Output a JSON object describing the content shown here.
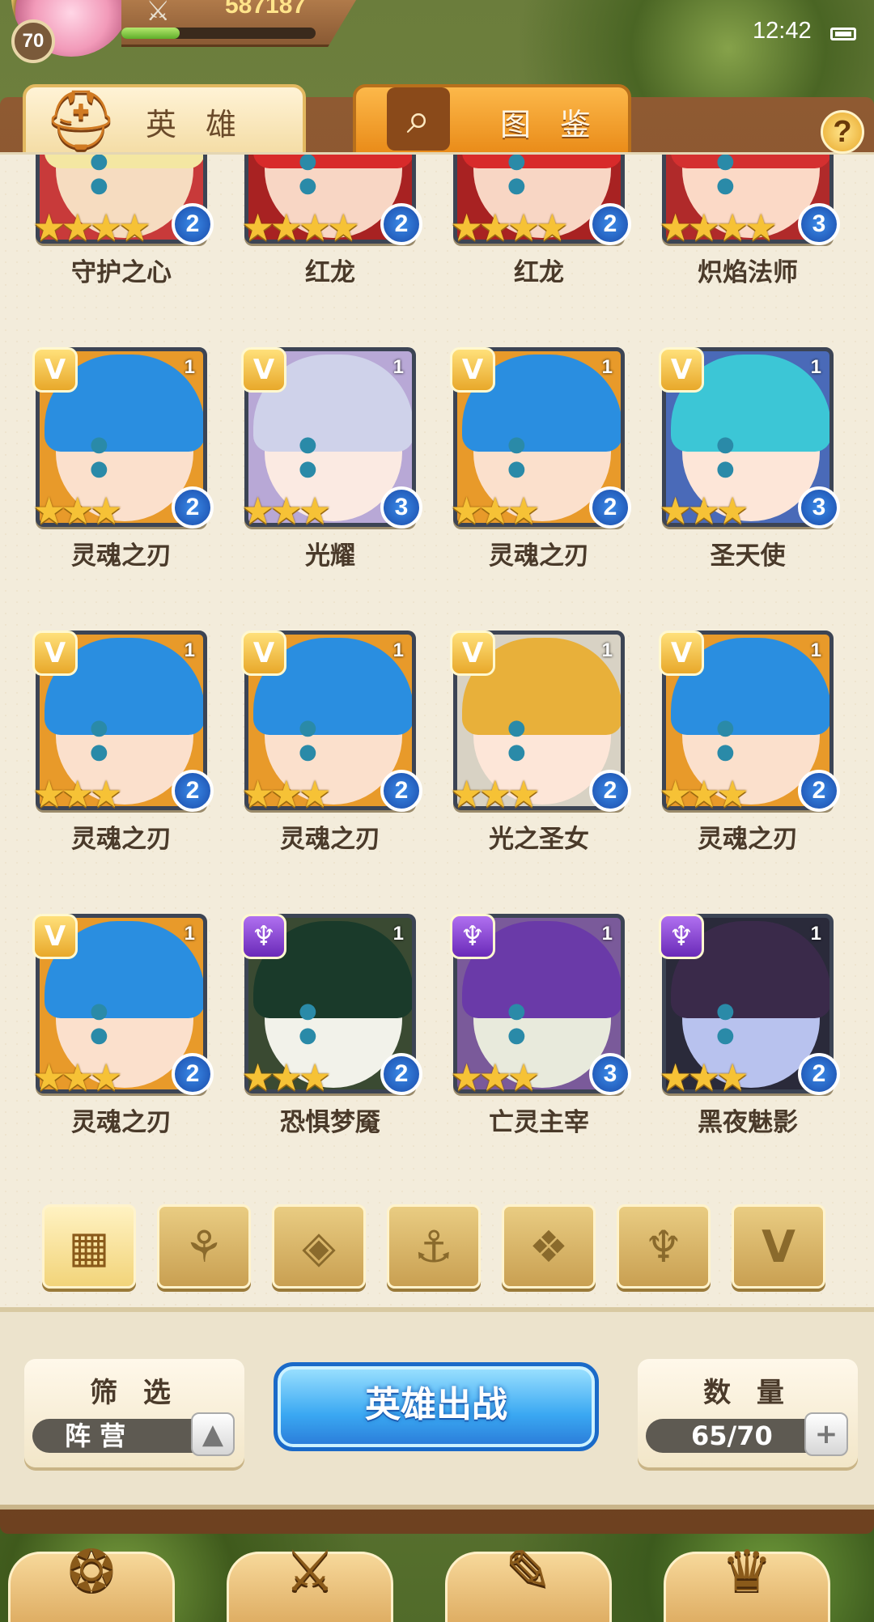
{
  "status": {
    "clock": "12:42"
  },
  "player": {
    "level": "70",
    "power": "587187",
    "exp_fraction": 0.3
  },
  "tabs": {
    "hero": "英 雄",
    "codex": "图 鉴"
  },
  "help_label": "?",
  "heroes": [
    {
      "name": "守护之心",
      "stars": 4,
      "level": "2",
      "faction": "gold",
      "rank": "",
      "portrait_color": "#f6dcc0",
      "hair_color": "#f4e7a2",
      "bg": "#c83a3a"
    },
    {
      "name": "红龙",
      "stars": 4,
      "level": "2",
      "faction": "gold",
      "rank": "",
      "portrait_color": "#f8d6c4",
      "hair_color": "#d82a2a",
      "bg": "#a82222"
    },
    {
      "name": "红龙",
      "stars": 4,
      "level": "2",
      "faction": "gold",
      "rank": "",
      "portrait_color": "#f8d6c4",
      "hair_color": "#d82a2a",
      "bg": "#a82222"
    },
    {
      "name": "炽焰法师",
      "stars": 4,
      "level": "3",
      "faction": "gold",
      "rank": "",
      "portrait_color": "#fbd9c6",
      "hair_color": "#d43030",
      "bg": "#b02a2a"
    },
    {
      "name": "灵魂之刃",
      "stars": 3,
      "level": "2",
      "faction": "gold",
      "rank": "1",
      "portrait_color": "#fbe0cc",
      "hair_color": "#2a8ee0",
      "bg": "#e89a2a"
    },
    {
      "name": "光耀",
      "stars": 3,
      "level": "3",
      "faction": "gold",
      "rank": "1",
      "portrait_color": "#fbeae2",
      "hair_color": "#cfd2ea",
      "bg": "#b8a8d6"
    },
    {
      "name": "灵魂之刃",
      "stars": 3,
      "level": "2",
      "faction": "gold",
      "rank": "1",
      "portrait_color": "#fbe0cc",
      "hair_color": "#2a8ee0",
      "bg": "#e89a2a"
    },
    {
      "name": "圣天使",
      "stars": 3,
      "level": "3",
      "faction": "gold",
      "rank": "1",
      "portrait_color": "#fde6d8",
      "hair_color": "#3cc6d6",
      "bg": "#4a6ab8"
    },
    {
      "name": "灵魂之刃",
      "stars": 3,
      "level": "2",
      "faction": "gold",
      "rank": "1",
      "portrait_color": "#fbe0cc",
      "hair_color": "#2a8ee0",
      "bg": "#e89a2a"
    },
    {
      "name": "灵魂之刃",
      "stars": 3,
      "level": "2",
      "faction": "gold",
      "rank": "1",
      "portrait_color": "#fbe0cc",
      "hair_color": "#2a8ee0",
      "bg": "#e89a2a"
    },
    {
      "name": "光之圣女",
      "stars": 3,
      "level": "2",
      "faction": "gold",
      "rank": "1",
      "portrait_color": "#fde6d8",
      "hair_color": "#e8b03a",
      "bg": "#d8d2c4"
    },
    {
      "name": "灵魂之刃",
      "stars": 3,
      "level": "2",
      "faction": "gold",
      "rank": "1",
      "portrait_color": "#fbe0cc",
      "hair_color": "#2a8ee0",
      "bg": "#e89a2a"
    },
    {
      "name": "灵魂之刃",
      "stars": 3,
      "level": "2",
      "faction": "gold",
      "rank": "1",
      "portrait_color": "#fbe0cc",
      "hair_color": "#2a8ee0",
      "bg": "#e89a2a"
    },
    {
      "name": "恐惧梦魇",
      "stars": 3,
      "level": "2",
      "faction": "purple",
      "rank": "1",
      "portrait_color": "#f2f2ea",
      "hair_color": "#1a3a2a",
      "bg": "#3a4a32"
    },
    {
      "name": "亡灵主宰",
      "stars": 3,
      "level": "3",
      "faction": "purple",
      "rank": "1",
      "portrait_color": "#e8eadc",
      "hair_color": "#6a3aa8",
      "bg": "#7a5a9a"
    },
    {
      "name": "黑夜魅影",
      "stars": 3,
      "level": "2",
      "faction": "purple",
      "rank": "1",
      "portrait_color": "#b8c2ee",
      "hair_color": "#3a2a4a",
      "bg": "#2a2a3a"
    }
  ],
  "filters": [
    {
      "icon": "all-icon",
      "glyph": "▦",
      "active": true
    },
    {
      "icon": "nature-faction-icon",
      "glyph": "⚘",
      "active": false
    },
    {
      "icon": "diamond-faction-icon",
      "glyph": "◈",
      "active": false
    },
    {
      "icon": "anchor-faction-icon",
      "glyph": "⚓",
      "active": false
    },
    {
      "icon": "beast-faction-icon",
      "glyph": "❖",
      "active": false
    },
    {
      "icon": "demon-faction-icon",
      "glyph": "♆",
      "active": false
    },
    {
      "icon": "light-faction-icon",
      "glyph": "V",
      "active": false
    }
  ],
  "bottom": {
    "filter_title": "筛 选",
    "filter_value": "阵 营",
    "filter_toggle": "▲",
    "deploy_label": "英雄出战",
    "count_title": "数 量",
    "count_value": "65/70",
    "count_add": "+"
  },
  "nav": [
    {
      "icon": "emblem-icon",
      "glyph": "❂"
    },
    {
      "icon": "swords-icon",
      "glyph": "⚔"
    },
    {
      "icon": "scroll-icon",
      "glyph": "✎"
    },
    {
      "icon": "crown-icon",
      "glyph": "♛"
    }
  ]
}
